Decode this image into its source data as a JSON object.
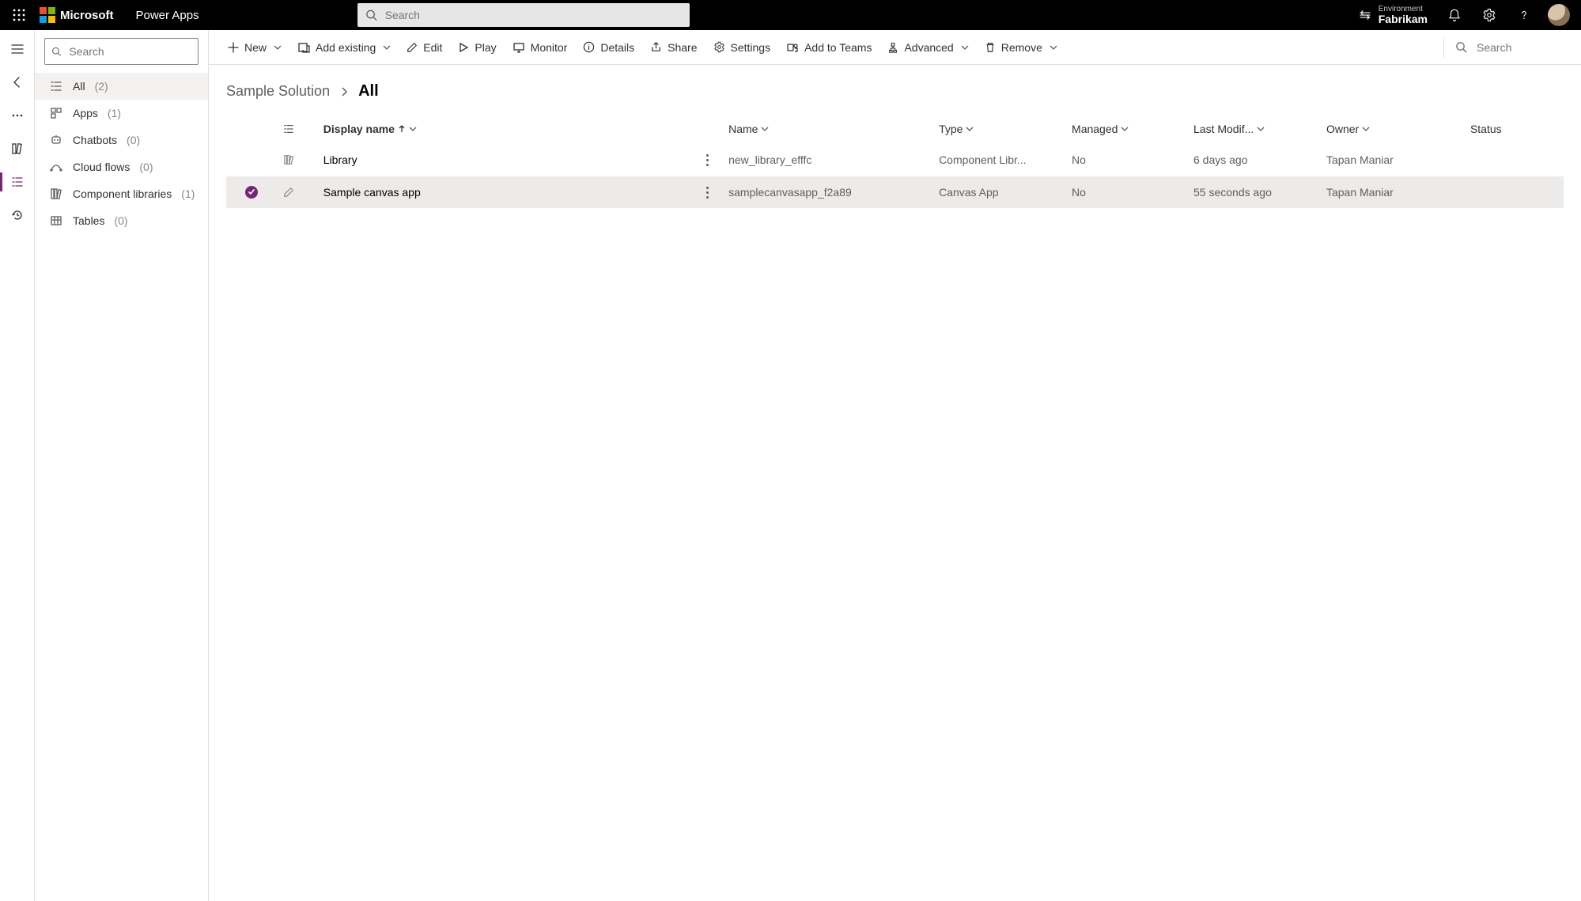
{
  "topbar": {
    "brand": "Microsoft",
    "app_title": "Power Apps",
    "search_placeholder": "Search",
    "env_label": "Environment",
    "env_name": "Fabrikam"
  },
  "commandbar": {
    "new": "New",
    "add_existing": "Add existing",
    "edit": "Edit",
    "play": "Play",
    "monitor": "Monitor",
    "details": "Details",
    "share": "Share",
    "settings": "Settings",
    "add_to_teams": "Add to Teams",
    "advanced": "Advanced",
    "remove": "Remove",
    "search_placeholder": "Search"
  },
  "sidebar": {
    "search_placeholder": "Search",
    "items": [
      {
        "label": "All",
        "count": "(2)",
        "active": true
      },
      {
        "label": "Apps",
        "count": "(1)"
      },
      {
        "label": "Chatbots",
        "count": "(0)"
      },
      {
        "label": "Cloud flows",
        "count": "(0)"
      },
      {
        "label": "Component libraries",
        "count": "(1)"
      },
      {
        "label": "Tables",
        "count": "(0)"
      }
    ]
  },
  "breadcrumb": {
    "solution": "Sample Solution",
    "current": "All"
  },
  "columns": {
    "display_name": "Display name",
    "name": "Name",
    "type": "Type",
    "managed": "Managed",
    "last_modified": "Last Modif...",
    "owner": "Owner",
    "status": "Status"
  },
  "rows": [
    {
      "selected": false,
      "display_name": "Library",
      "name": "new_library_efffc",
      "type": "Component Libr...",
      "managed": "No",
      "last_modified": "6 days ago",
      "owner": "Tapan Maniar",
      "status": ""
    },
    {
      "selected": true,
      "display_name": "Sample canvas app",
      "name": "samplecanvasapp_f2a89",
      "type": "Canvas App",
      "managed": "No",
      "last_modified": "55 seconds ago",
      "owner": "Tapan Maniar",
      "status": ""
    }
  ]
}
